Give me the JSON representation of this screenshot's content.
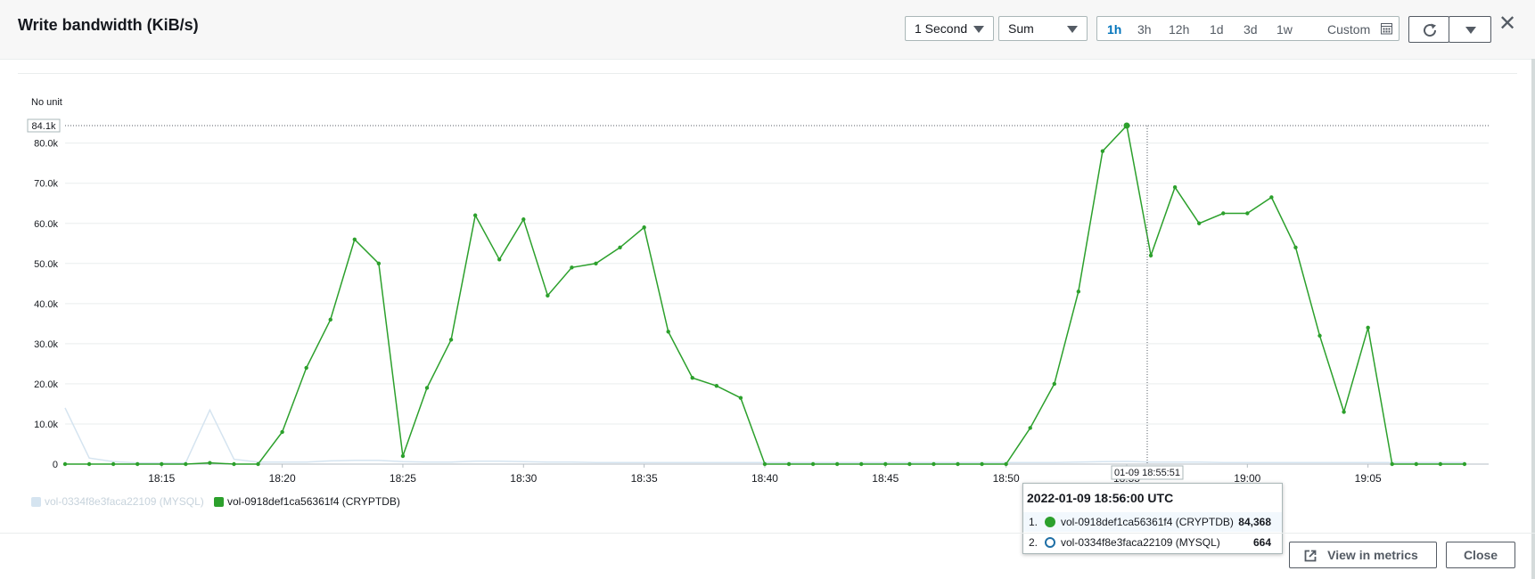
{
  "header": {
    "title": "Write bandwidth (KiB/s)",
    "period_select": "1 Second",
    "stat_select": "Sum",
    "ranges": [
      "1h",
      "3h",
      "12h",
      "1d",
      "3d",
      "1w"
    ],
    "active_range": "1h",
    "custom_label": "Custom"
  },
  "footer": {
    "view_in_metrics": "View in metrics",
    "close": "Close"
  },
  "tooltip": {
    "title": "2022-01-09 18:56:00 UTC",
    "rows": [
      {
        "index": "1.",
        "name": "vol-0918def1ca56361f4 (CRYPTDB)",
        "value": "84,368"
      },
      {
        "index": "2.",
        "name": "vol-0334f8e3faca22109 (MYSQL)",
        "value": "664"
      }
    ]
  },
  "chart_data": {
    "type": "line",
    "unit_label": "No unit",
    "ylim": [
      0,
      84368
    ],
    "y_ticks": [
      "0",
      "10.0k",
      "20.0k",
      "30.0k",
      "40.0k",
      "50.0k",
      "60.0k",
      "70.0k",
      "80.0k"
    ],
    "y_tick_values": [
      0,
      10000,
      20000,
      30000,
      40000,
      50000,
      60000,
      70000,
      80000
    ],
    "max_label": "84.1k",
    "max_value": 84368,
    "x_ticks": [
      "18:15",
      "18:20",
      "18:25",
      "18:30",
      "18:35",
      "18:40",
      "18:45",
      "18:50",
      "18:55",
      "19:00",
      "19:05"
    ],
    "x_tick_minutes": [
      15,
      20,
      25,
      30,
      35,
      40,
      45,
      50,
      55,
      60,
      65
    ],
    "xlim_minutes": [
      11,
      70
    ],
    "cursor_label": "01-09 18:55:51",
    "cursor_minute": 55.85,
    "legend": [
      {
        "name": "vol-0334f8e3faca22109 (MYSQL)",
        "color": "#d5e4f0"
      },
      {
        "name": "vol-0918def1ca56361f4 (CRYPTDB)",
        "color": "#2ca02c"
      }
    ],
    "series": [
      {
        "name": "vol-0918def1ca56361f4 (CRYPTDB)",
        "color": "#2ca02c",
        "x_minutes": [
          11,
          12,
          13,
          14,
          15,
          16,
          17,
          18,
          19,
          20,
          21,
          22,
          23,
          24,
          25,
          26,
          27,
          28,
          29,
          30,
          31,
          32,
          33,
          34,
          35,
          36,
          37,
          38,
          39,
          40,
          41,
          42,
          43,
          44,
          45,
          46,
          47,
          48,
          49,
          50,
          51,
          52,
          53,
          54,
          55,
          56,
          57,
          58,
          59,
          60,
          61,
          62,
          63,
          64,
          65,
          66,
          67,
          68,
          69
        ],
        "values": [
          0,
          0,
          0,
          0,
          0,
          0,
          300,
          0,
          0,
          8000,
          24000,
          36000,
          56000,
          50000,
          2000,
          19000,
          31000,
          62000,
          51000,
          61000,
          42000,
          49000,
          50000,
          54000,
          59000,
          33000,
          21500,
          19500,
          16500,
          0,
          0,
          0,
          0,
          0,
          0,
          0,
          0,
          0,
          0,
          0,
          9000,
          20000,
          43000,
          78000,
          84368,
          52000,
          69000,
          60000,
          62500,
          62500,
          66500,
          54000,
          32000,
          13000,
          34000,
          0,
          0,
          0,
          0
        ]
      },
      {
        "name": "vol-0334f8e3faca22109 (MYSQL)",
        "color": "#d5e4f0",
        "x_minutes": [
          11,
          12,
          13,
          14,
          15,
          16,
          17,
          18,
          19,
          20,
          21,
          22,
          23,
          24,
          25,
          26,
          27,
          28,
          29,
          30,
          31,
          32,
          33,
          34,
          35,
          36,
          37,
          38,
          39,
          40,
          41,
          42,
          43,
          44,
          45,
          46,
          47,
          48,
          49,
          50,
          51,
          52,
          53,
          54,
          55,
          56,
          57,
          58,
          59,
          60,
          61,
          62,
          63,
          64,
          65,
          66,
          67,
          68,
          69
        ],
        "values": [
          14000,
          1500,
          600,
          300,
          300,
          300,
          13500,
          1200,
          500,
          500,
          500,
          800,
          900,
          900,
          600,
          500,
          500,
          700,
          700,
          600,
          500,
          500,
          400,
          400,
          400,
          400,
          400,
          400,
          400,
          400,
          400,
          400,
          400,
          400,
          400,
          400,
          400,
          400,
          400,
          400,
          400,
          400,
          500,
          600,
          664,
          500,
          500,
          500,
          400,
          400,
          400,
          400,
          400,
          400,
          400,
          400,
          400,
          400,
          400
        ]
      }
    ]
  }
}
